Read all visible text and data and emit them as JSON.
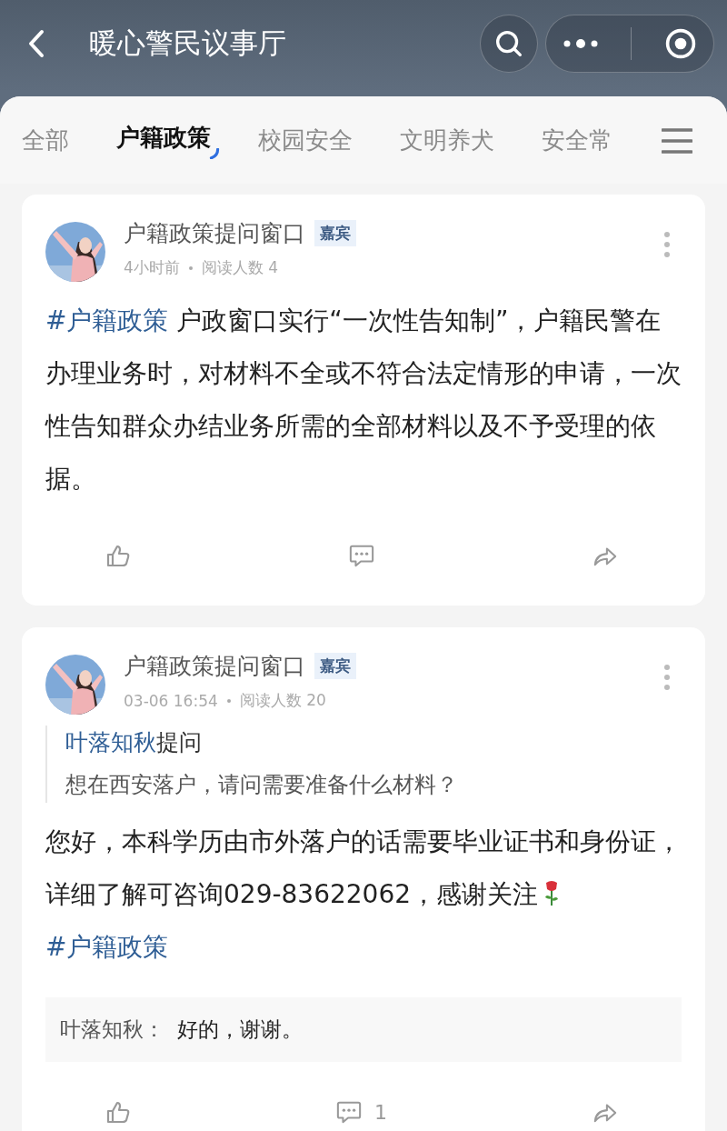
{
  "header": {
    "title": "暖心警民议事厅"
  },
  "tabs": [
    {
      "label": "全部",
      "selected": false
    },
    {
      "label": "户籍政策",
      "selected": true
    },
    {
      "label": "校园安全",
      "selected": false
    },
    {
      "label": "文明养犬",
      "selected": false
    },
    {
      "label": "安全常",
      "selected": false
    }
  ],
  "posts": [
    {
      "author": "户籍政策提问窗口",
      "badge": "嘉宾",
      "time": "4小时前",
      "reads": "阅读人数 4",
      "body": [
        {
          "kind": "hashtag",
          "text": "#户籍政策"
        },
        {
          "kind": "text",
          "text": " 户政窗口实行“一次性告知制”，户籍民警在办理业务时，对材料不全或不符合法定情形的申请，一次性告知群众办结业务所需的全部材料以及不予受理的依据。"
        }
      ]
    },
    {
      "author": "户籍政策提问窗口",
      "badge": "嘉宾",
      "time": "03-06 16:54",
      "reads": "阅读人数 20",
      "question": {
        "asker": "叶落知秋",
        "label": "提问",
        "text": "想在西安落户，请问需要准备什么材料？"
      },
      "body": [
        {
          "kind": "text",
          "text": "您好，本科学历由市外落户的话需要毕业证书和身份证，详细了解可咨询029-83622062，感谢关注"
        },
        {
          "kind": "rose"
        },
        {
          "kind": "hashtag",
          "text": "#户籍政策"
        }
      ],
      "reply": {
        "author": "叶落知秋：",
        "text": "好的，谢谢。"
      },
      "comment_count": "1"
    }
  ]
}
